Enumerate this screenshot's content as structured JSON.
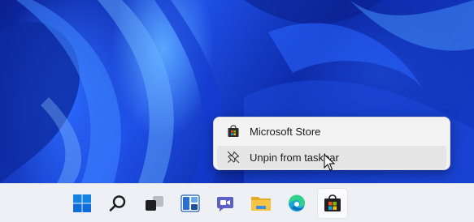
{
  "context_menu": {
    "items": [
      {
        "label": "Microsoft Store",
        "icon": "store-icon"
      },
      {
        "label": "Unpin from taskbar",
        "icon": "unpin-icon",
        "hovered": true
      }
    ]
  },
  "taskbar": {
    "icons": [
      "start-icon",
      "search-icon",
      "task-view-icon",
      "widgets-icon",
      "chat-icon",
      "file-explorer-icon",
      "edge-icon",
      "store-icon"
    ],
    "active_icon": "store-icon"
  },
  "colors": {
    "wallpaper_base": "#1b3fc4",
    "menu_bg": "#f3f3f3",
    "menu_hover": "#e5e5e5",
    "taskbar_bg": "#eef0f6",
    "windows_blue": "#0f6cd9",
    "chat_purple": "#5b5fc7",
    "folder_yellow": "#f6c443"
  }
}
